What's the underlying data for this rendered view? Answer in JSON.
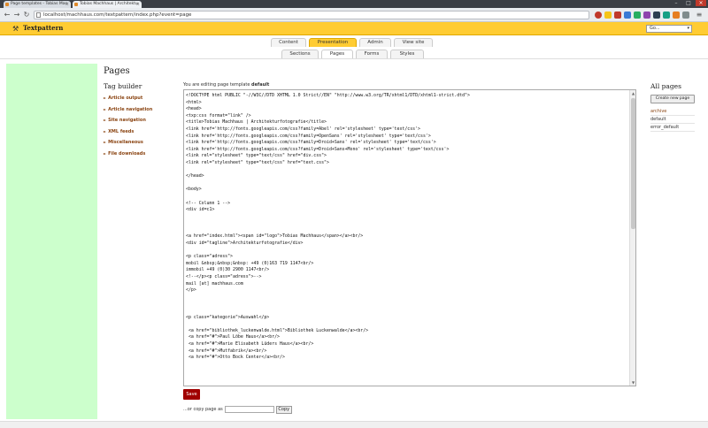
{
  "browser": {
    "tabs": [
      {
        "title": "Page templates - Tobias Mac"
      },
      {
        "title": "Tobias Machhaus | Architektu"
      }
    ],
    "url": "localhost/machhaus.com/textpattern/index.php?event=page"
  },
  "header": {
    "logo": "Textpattern",
    "goto_value": "Go..."
  },
  "primary_tabs": [
    {
      "label": "Content"
    },
    {
      "label": "Presentation"
    },
    {
      "label": "Admin"
    },
    {
      "label": "View site"
    }
  ],
  "secondary_tabs": [
    {
      "label": "Sections"
    },
    {
      "label": "Pages"
    },
    {
      "label": "Forms"
    },
    {
      "label": "Styles"
    }
  ],
  "main": {
    "title": "Pages",
    "tag_builder_title": "Tag builder",
    "tag_items": [
      "Article output",
      "Article navigation",
      "Site navigation",
      "XML feeds",
      "Miscellaneous",
      "File downloads"
    ],
    "editing_prefix": "You are editing page template",
    "editing_name": "default",
    "code_lines": [
      "<!DOCTYPE html PUBLIC \"-//W3C//DTD XHTML 1.0 Strict//EN\" \"http://www.w3.org/TR/xhtml1/DTD/xhtml1-strict.dtd\">",
      "<html>",
      "<head>",
      "<txp:css format=\"link\" />",
      "<title>Tobias Machhaus | Architekturfotografie</title>",
      "<link href='http://fonts.googleapis.com/css?family=Abel' rel='stylesheet' type='text/css'>",
      "<link href='http://fonts.googleapis.com/css?family=OpenSans' rel='stylesheet' type='text/css'>",
      "<link href='http://fonts.googleapis.com/css?family=Droid+Sans' rel='stylesheet' type='text/css'>",
      "<link href='http://fonts.googleapis.com/css?family=Droid+Sans+Mono' rel='stylesheet' type='text/css'>",
      "<link rel=\"stylesheet\" type=\"text/css\" href=\"div.css\">",
      "<link rel=\"stylesheet\" type=\"text/css\" href=\"text.css\">",
      "",
      "</head>",
      "",
      "<body>",
      "",
      "<!-- Column 1 -->",
      "<div id=c1>",
      "",
      "",
      "",
      "<a href=\"index.html\"><span id=\"logo\">Tobias Machhaus</span></a><br/>",
      "<div id=\"tagline\">Architekturfotografie</div>",
      "",
      "<p class=\"adress\">",
      "mobil &nbsp;&nbsp;&nbsp: +49 (0)163 719 1147<br/>",
      "immobil +49 (0)30 2900 1147<br/>",
      "<!--</p><p class=\"adress\">-->",
      "mail [at] machhaus.com",
      "</p>",
      "",
      "",
      "",
      "<p class=\"kategorie\">Auswahl</p>",
      "",
      " <a href=\"bibliothek_luckenwalde.html\">Bibliothek Luckenwalde</a><br/>",
      " <a href=\"#\">Paul Löbe Haus</a><br/>",
      " <a href=\"#\">Marie Elisabeth Lüders Haus</a><br/>",
      " <a href=\"#\">Mutfabrik</a><br/>",
      " <a href=\"#\">Otto Bock Center</a><br/>"
    ],
    "save_label": "Save",
    "copy_label": "...or copy page as",
    "copy_button": "Copy"
  },
  "all_pages": {
    "title": "All pages",
    "create_label": "Create new page",
    "items": [
      "archive",
      "default",
      "error_default"
    ]
  }
}
